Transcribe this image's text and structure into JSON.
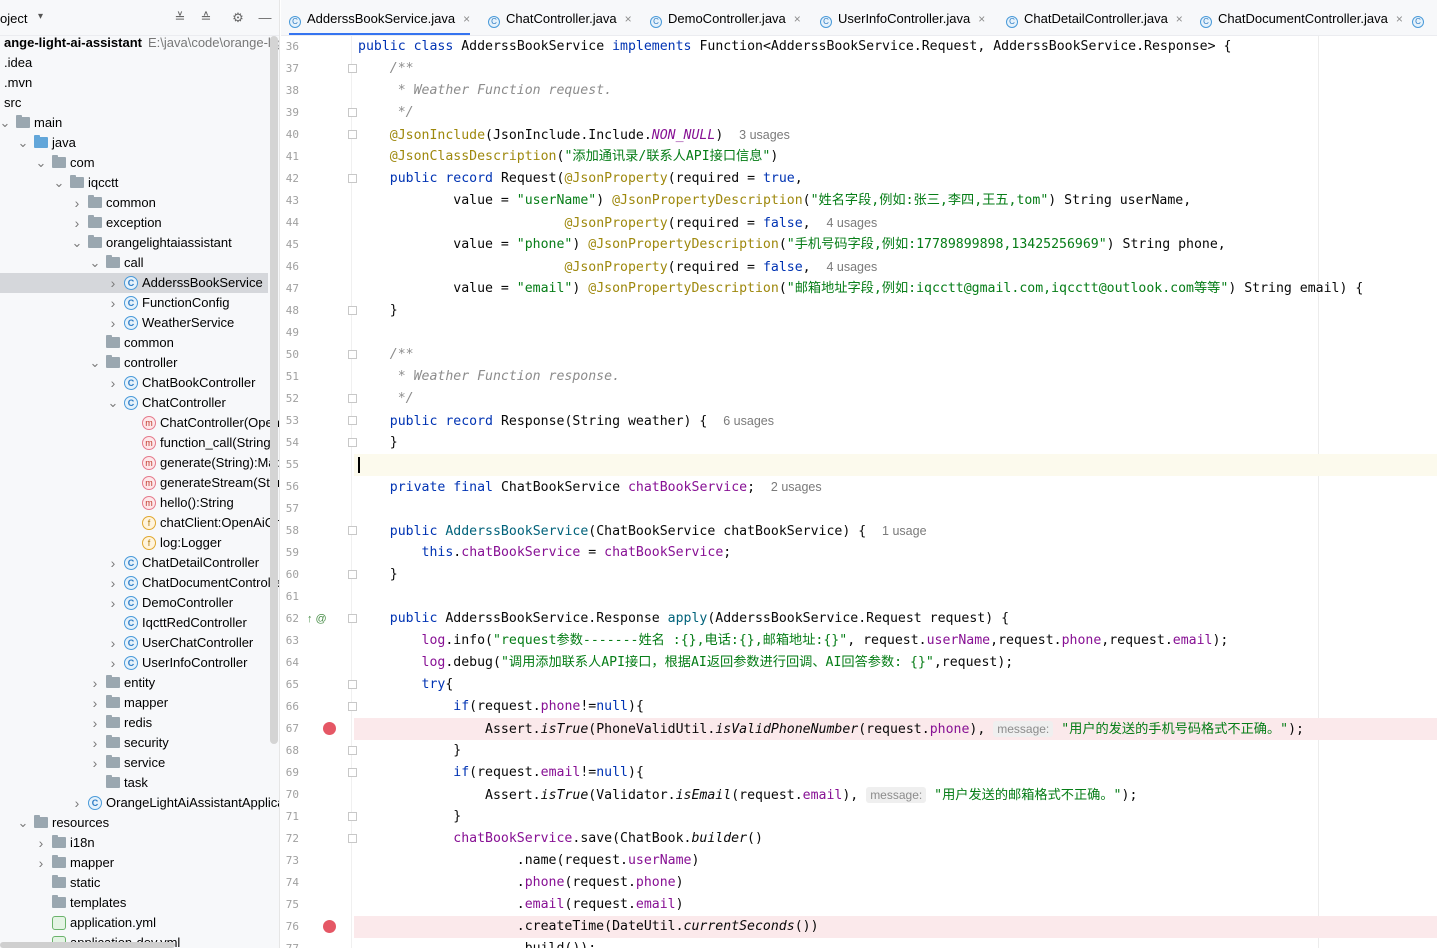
{
  "project_panel": {
    "title": "oject",
    "icons": [
      "collapse-all-icon",
      "expand-all-icon",
      "gear-icon",
      "minimize-icon"
    ]
  },
  "tree": [
    {
      "label": "ange-light-ai-assistant",
      "path": "E:\\java\\code\\orange-ligl",
      "bold": true,
      "icon": "none"
    },
    {
      "label": ".idea",
      "icon": "none"
    },
    {
      "label": ".mvn",
      "icon": "none"
    },
    {
      "label": "src",
      "icon": "none"
    },
    {
      "label": "main",
      "icon": "folder",
      "chev": "down"
    },
    {
      "label": "java",
      "icon": "folder-blue",
      "chev": "down"
    },
    {
      "label": "com",
      "icon": "folder",
      "chev": "down"
    },
    {
      "label": "iqcctt",
      "icon": "folder",
      "chev": "down"
    },
    {
      "label": "common",
      "icon": "folder",
      "chev": "right"
    },
    {
      "label": "exception",
      "icon": "folder",
      "chev": "right"
    },
    {
      "label": "orangelightaiassistant",
      "icon": "folder",
      "chev": "down"
    },
    {
      "label": "call",
      "icon": "folder",
      "chev": "down"
    },
    {
      "label": "AdderssBookService",
      "icon": "class",
      "chev": "right",
      "selected": true
    },
    {
      "label": "FunctionConfig",
      "icon": "class",
      "chev": "right"
    },
    {
      "label": "WeatherService",
      "icon": "class",
      "chev": "right"
    },
    {
      "label": "common",
      "icon": "folder",
      "chev": "none"
    },
    {
      "label": "controller",
      "icon": "folder",
      "chev": "down"
    },
    {
      "label": "ChatBookController",
      "icon": "class",
      "chev": "right"
    },
    {
      "label": "ChatController",
      "icon": "class",
      "chev": "down"
    },
    {
      "label": "ChatController(OpenAiC",
      "icon": "method"
    },
    {
      "label": "function_call(String):Stri",
      "icon": "method"
    },
    {
      "label": "generate(String):Map",
      "icon": "method"
    },
    {
      "label": "generateStream(String)",
      "icon": "method"
    },
    {
      "label": "hello():String",
      "icon": "method"
    },
    {
      "label": "chatClient:OpenAiChatC",
      "icon": "field"
    },
    {
      "label": "log:Logger",
      "icon": "field"
    },
    {
      "label": "ChatDetailController",
      "icon": "class",
      "chev": "right"
    },
    {
      "label": "ChatDocumentController",
      "icon": "class",
      "chev": "right"
    },
    {
      "label": "DemoController",
      "icon": "class",
      "chev": "right"
    },
    {
      "label": "IqcttRedController",
      "icon": "class",
      "chev": "none"
    },
    {
      "label": "UserChatController",
      "icon": "class",
      "chev": "right"
    },
    {
      "label": "UserInfoController",
      "icon": "class",
      "chev": "right"
    },
    {
      "label": "entity",
      "icon": "folder",
      "chev": "right"
    },
    {
      "label": "mapper",
      "icon": "folder",
      "chev": "right"
    },
    {
      "label": "redis",
      "icon": "folder",
      "chev": "right"
    },
    {
      "label": "security",
      "icon": "folder",
      "chev": "right"
    },
    {
      "label": "service",
      "icon": "folder",
      "chev": "right"
    },
    {
      "label": "task",
      "icon": "folder",
      "chev": "none"
    },
    {
      "label": "OrangeLightAiAssistantApplica",
      "icon": "class",
      "chev": "right"
    },
    {
      "label": "resources",
      "icon": "folder",
      "chev": "down"
    },
    {
      "label": "i18n",
      "icon": "folder",
      "chev": "right"
    },
    {
      "label": "mapper",
      "icon": "folder",
      "chev": "right"
    },
    {
      "label": "static",
      "icon": "folder",
      "chev": "none"
    },
    {
      "label": "templates",
      "icon": "folder",
      "chev": "none"
    },
    {
      "label": "application.yml",
      "icon": "yml"
    },
    {
      "label": "application-dev.yml",
      "icon": "yml"
    }
  ],
  "tabs": [
    {
      "label": "AdderssBookService.java",
      "active": true
    },
    {
      "label": "ChatController.java"
    },
    {
      "label": "DemoController.java"
    },
    {
      "label": "UserInfoController.java"
    },
    {
      "label": "ChatDetailController.java"
    },
    {
      "label": "ChatDocumentController.java"
    }
  ],
  "tab_close_glyph": "×",
  "editor": {
    "current_line": 55,
    "breakpoints": [
      67,
      76
    ],
    "gutter_marks": {
      "62": "↑ @"
    },
    "lines": [
      {
        "n": 36,
        "t": "public class AdderssBookService implements Function<AdderssBookService.Request, AdderssBookService.Response> {"
      },
      {
        "n": 37,
        "t": "    /**"
      },
      {
        "n": 38,
        "t": "     * Weather Function request."
      },
      {
        "n": 39,
        "t": "     */"
      },
      {
        "n": 40,
        "t": "    @JsonInclude(JsonInclude.Include.NON_NULL)",
        "hint": "3 usages"
      },
      {
        "n": 41,
        "t": "    @JsonClassDescription(\"添加通讯录/联系人API接口信息\")"
      },
      {
        "n": 42,
        "t": "    public record Request(@JsonProperty(required = true,"
      },
      {
        "n": 43,
        "t": "            value = \"userName\") @JsonPropertyDescription(\"姓名字段,例如:张三,李四,王五,tom\") String userName,"
      },
      {
        "n": 44,
        "t": "                          @JsonProperty(required = false,",
        "hint": "4 usages"
      },
      {
        "n": 45,
        "t": "            value = \"phone\") @JsonPropertyDescription(\"手机号码字段,例如:17789899898,13425256969\") String phone,"
      },
      {
        "n": 46,
        "t": "                          @JsonProperty(required = false,",
        "hint": "4 usages"
      },
      {
        "n": 47,
        "t": "            value = \"email\") @JsonPropertyDescription(\"邮箱地址字段,例如:iqcctt@gmail.com,iqcctt@outlook.com等等\") String email) {"
      },
      {
        "n": 48,
        "t": "    }"
      },
      {
        "n": 49,
        "t": ""
      },
      {
        "n": 50,
        "t": "    /**"
      },
      {
        "n": 51,
        "t": "     * Weather Function response."
      },
      {
        "n": 52,
        "t": "     */"
      },
      {
        "n": 53,
        "t": "    public record Response(String weather) {",
        "hint": "6 usages"
      },
      {
        "n": 54,
        "t": "    }"
      },
      {
        "n": 55,
        "t": ""
      },
      {
        "n": 56,
        "t": "    private final ChatBookService chatBookService;",
        "hint": "2 usages"
      },
      {
        "n": 57,
        "t": ""
      },
      {
        "n": 58,
        "t": "    public AdderssBookService(ChatBookService chatBookService) {",
        "hint": "1 usage"
      },
      {
        "n": 59,
        "t": "        this.chatBookService = chatBookService;"
      },
      {
        "n": 60,
        "t": "    }"
      },
      {
        "n": 61,
        "t": ""
      },
      {
        "n": 62,
        "t": "    public AdderssBookService.Response apply(AdderssBookService.Request request) {"
      },
      {
        "n": 63,
        "t": "        log.info(\"request参数-------姓名 :{},电话:{},邮箱地址:{}\", request.userName,request.phone,request.email);"
      },
      {
        "n": 64,
        "t": "        log.debug(\"调用添加联系人API接口，根据AI返回参数进行回调、AI回答参数: {}\",request);"
      },
      {
        "n": 65,
        "t": "        try{"
      },
      {
        "n": 66,
        "t": "            if(request.phone!=null){"
      },
      {
        "n": 67,
        "t": "                Assert.isTrue(PhoneValidUtil.isValidPhoneNumber(request.phone), ",
        "param": "message:",
        "tail": "\"用户的发送的手机号码格式不正确。\");"
      },
      {
        "n": 68,
        "t": "            }"
      },
      {
        "n": 69,
        "t": "            if(request.email!=null){"
      },
      {
        "n": 70,
        "t": "                Assert.isTrue(Validator.isEmail(request.email), ",
        "param": "message:",
        "tail": "\"用户发送的邮箱格式不正确。\");"
      },
      {
        "n": 71,
        "t": "            }"
      },
      {
        "n": 72,
        "t": "            chatBookService.save(ChatBook.builder()"
      },
      {
        "n": 73,
        "t": "                    .name(request.userName)"
      },
      {
        "n": 74,
        "t": "                    .phone(request.phone)"
      },
      {
        "n": 75,
        "t": "                    .email(request.email)"
      },
      {
        "n": 76,
        "t": "                    .createTime(DateUtil.currentSeconds())"
      },
      {
        "n": 77,
        "t": "                    .build());"
      }
    ]
  },
  "colors": {
    "keyword": "#0033b3",
    "string": "#067d17",
    "annotation": "#9e880d",
    "comment": "#8c8c8c",
    "field": "#871094",
    "accent": "#3574f0",
    "breakpoint": "#e55765"
  }
}
